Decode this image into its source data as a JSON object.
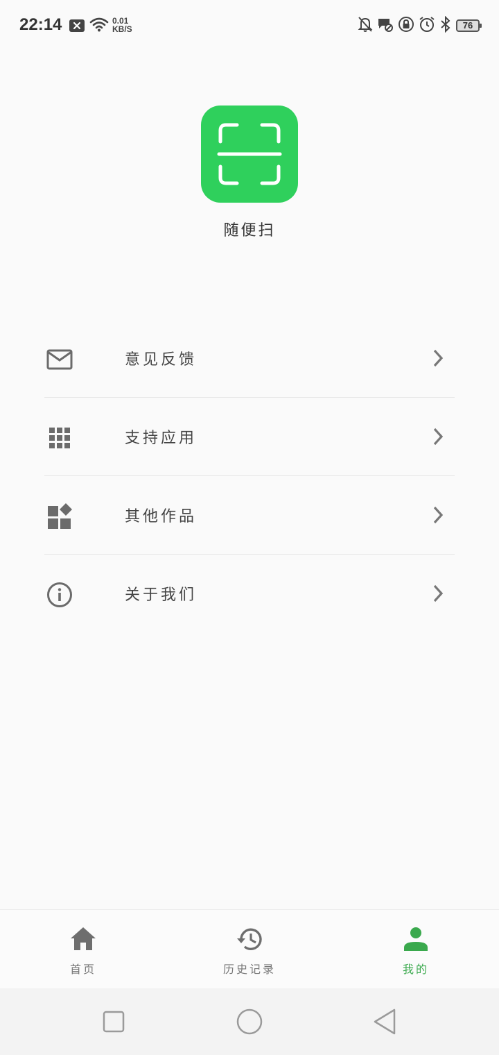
{
  "status_bar": {
    "time": "22:14",
    "net_speed_value": "0.01",
    "net_speed_unit": "KB/S",
    "battery": "76",
    "icons": [
      "notification-x-icon",
      "wifi-icon",
      "bell-off-icon",
      "message-blocked-icon",
      "lock-rotation-icon",
      "alarm-icon",
      "bluetooth-icon",
      "battery-icon"
    ]
  },
  "app": {
    "name": "随便扫",
    "logo_icon": "scan-frame-icon",
    "logo_color": "#2fd05c"
  },
  "menu": {
    "items": [
      {
        "label": "意见反馈",
        "icon": "mail-icon"
      },
      {
        "label": "支持应用",
        "icon": "apps-grid-icon"
      },
      {
        "label": "其他作品",
        "icon": "widgets-icon"
      },
      {
        "label": "关于我们",
        "icon": "info-icon"
      }
    ],
    "chevron_icon": "chevron-right-icon"
  },
  "bottom_nav": {
    "items": [
      {
        "label": "首页",
        "icon": "home-icon"
      },
      {
        "label": "历史记录",
        "icon": "history-icon"
      },
      {
        "label": "我的",
        "icon": "person-icon",
        "active": true
      }
    ],
    "active_color": "#3aa94d"
  },
  "system_nav": {
    "buttons": [
      "recents-square-icon",
      "home-circle-icon",
      "back-triangle-icon"
    ]
  }
}
